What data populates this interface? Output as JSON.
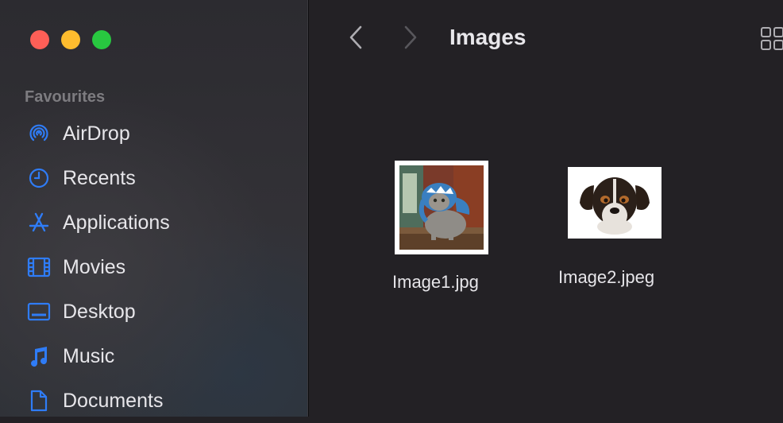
{
  "window": {
    "title": "Images",
    "traffic_lights": {
      "close": "#fe5f57",
      "minimize": "#febc2e",
      "zoom": "#28c840"
    }
  },
  "toolbar": {
    "back_icon": "chevron-left-icon",
    "forward_icon": "chevron-right-icon",
    "view_icon": "grid-view-icon"
  },
  "sidebar": {
    "section_label": "Favourites",
    "accent": "#2f7cf6",
    "items": [
      {
        "label": "AirDrop",
        "icon": "airdrop-icon"
      },
      {
        "label": "Recents",
        "icon": "clock-icon"
      },
      {
        "label": "Applications",
        "icon": "applications-icon"
      },
      {
        "label": "Movies",
        "icon": "film-icon"
      },
      {
        "label": "Desktop",
        "icon": "desktop-icon"
      },
      {
        "label": "Music",
        "icon": "music-note-icon"
      },
      {
        "label": "Documents",
        "icon": "document-icon"
      }
    ]
  },
  "files": [
    {
      "name": "Image1.jpg",
      "thumbnail": "cat in shark costume"
    },
    {
      "name": "Image2.jpeg",
      "thumbnail": "puppy face"
    }
  ]
}
